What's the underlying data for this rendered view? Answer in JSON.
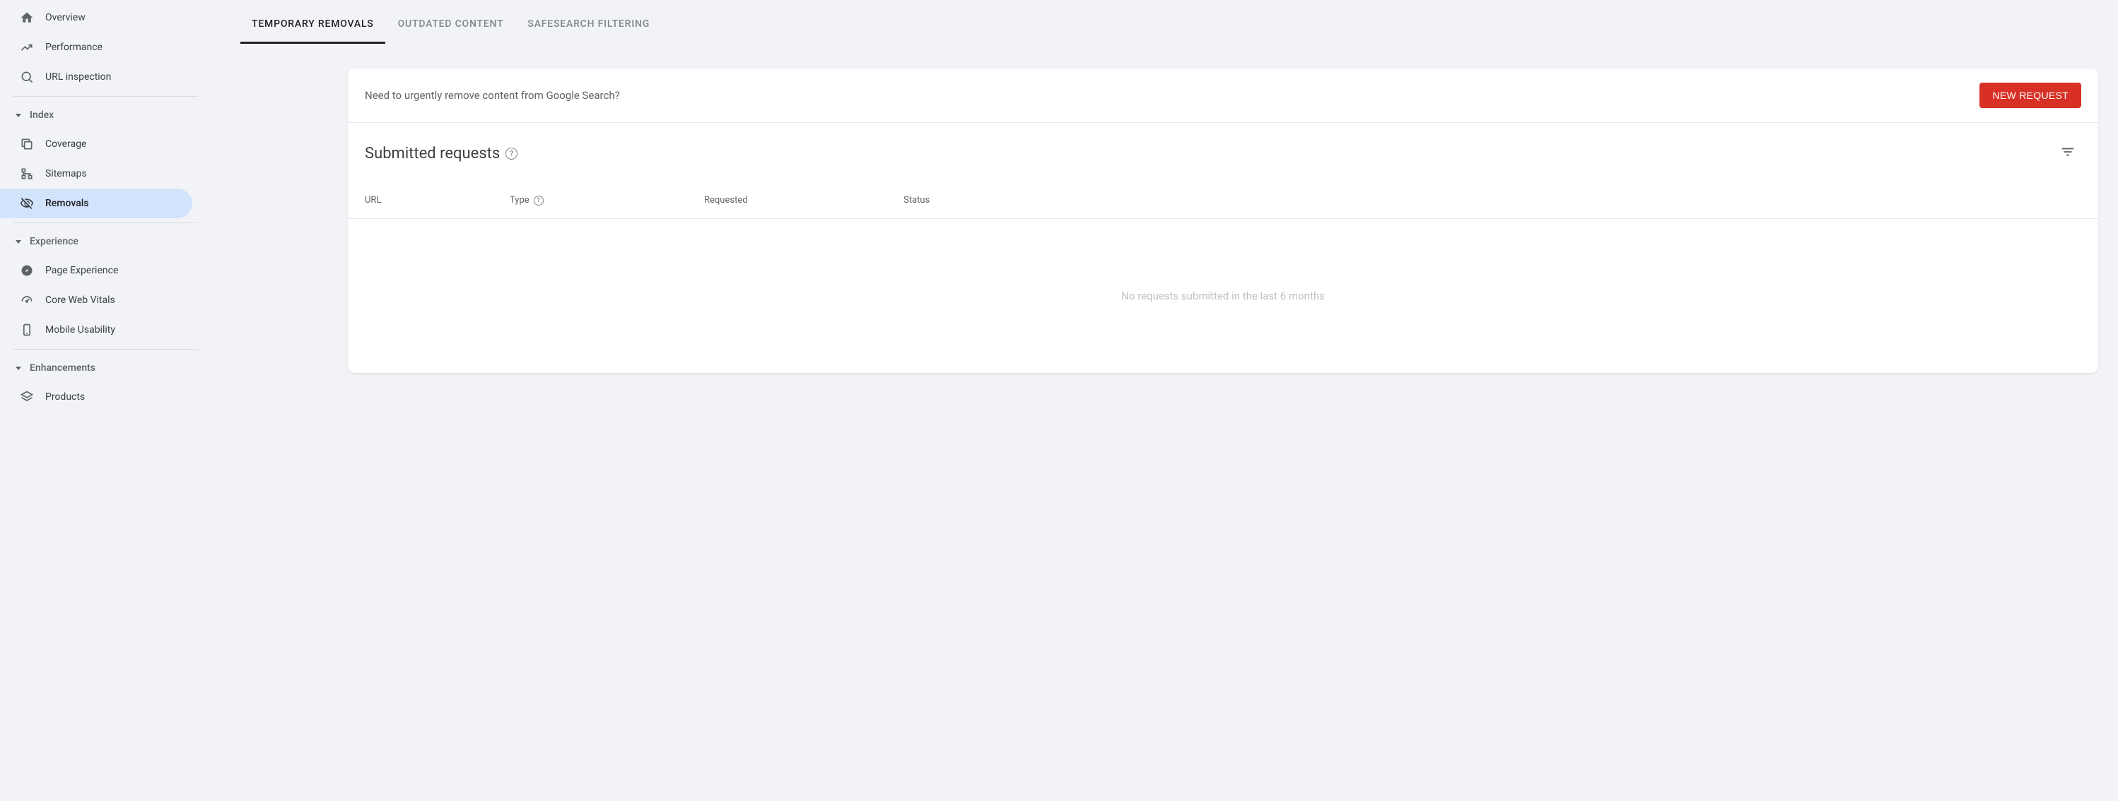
{
  "sidebar": {
    "top_items": [
      {
        "label": "Overview",
        "icon": "home"
      },
      {
        "label": "Performance",
        "icon": "trend"
      },
      {
        "label": "URL inspection",
        "icon": "search"
      }
    ],
    "sections": [
      {
        "title": "Index",
        "items": [
          {
            "label": "Coverage",
            "icon": "copy"
          },
          {
            "label": "Sitemaps",
            "icon": "tree"
          },
          {
            "label": "Removals",
            "icon": "eye-off",
            "active": true
          }
        ]
      },
      {
        "title": "Experience",
        "items": [
          {
            "label": "Page Experience",
            "icon": "compass"
          },
          {
            "label": "Core Web Vitals",
            "icon": "gauge"
          },
          {
            "label": "Mobile Usability",
            "icon": "phone"
          }
        ]
      },
      {
        "title": "Enhancements",
        "items": [
          {
            "label": "Products",
            "icon": "layers"
          }
        ]
      }
    ]
  },
  "tabs": [
    {
      "label": "TEMPORARY REMOVALS",
      "active": true
    },
    {
      "label": "OUTDATED CONTENT"
    },
    {
      "label": "SAFESEARCH FILTERING"
    }
  ],
  "card": {
    "prompt": "Need to urgently remove content from Google Search?",
    "new_request_label": "NEW REQUEST",
    "section_title": "Submitted requests",
    "columns": {
      "url": "URL",
      "type": "Type",
      "requested": "Requested",
      "status": "Status"
    },
    "empty_message": "No requests submitted in the last 6 months"
  }
}
